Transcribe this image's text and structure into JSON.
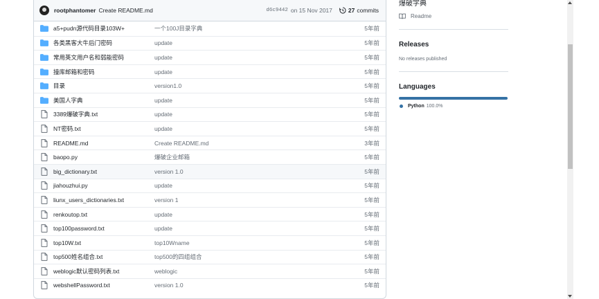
{
  "commit": {
    "author": "rootphantomer",
    "message": "Create README.md",
    "sha": "d6c9442",
    "date": "on 15 Nov 2017",
    "count": "27",
    "count_label": "commits"
  },
  "files": [
    {
      "type": "dir",
      "name": "a5+pudn源代码目录103W+",
      "msg": "一个100J目录字典",
      "date": "5年前"
    },
    {
      "type": "dir",
      "name": "各类黑客大牛后门密码",
      "msg": "update",
      "date": "5年前"
    },
    {
      "type": "dir",
      "name": "常用英文用户名和弱能密码",
      "msg": "update",
      "date": "5年前"
    },
    {
      "type": "dir",
      "name": "撞库邮箱和密码",
      "msg": "update",
      "date": "5年前"
    },
    {
      "type": "dir",
      "name": "目录",
      "msg": "version1.0",
      "date": "5年前"
    },
    {
      "type": "dir",
      "name": "美国人字典",
      "msg": "update",
      "date": "5年前"
    },
    {
      "type": "file",
      "name": "3389爆破字典.txt",
      "msg": "update",
      "date": "5年前"
    },
    {
      "type": "file",
      "name": "NT密码.txt",
      "msg": "update",
      "date": "5年前"
    },
    {
      "type": "file",
      "name": "README.md",
      "msg": "Create README.md",
      "date": "3年前"
    },
    {
      "type": "file",
      "name": "baopo.py",
      "msg": "爆破企业邮箱",
      "date": "5年前"
    },
    {
      "type": "file",
      "name": "big_dictionary.txt",
      "msg": "version 1.0",
      "date": "5年前"
    },
    {
      "type": "file",
      "name": "jiahouzhui.py",
      "msg": "update",
      "date": "5年前"
    },
    {
      "type": "file",
      "name": "liunx_users_dictionaries.txt",
      "msg": "version 1",
      "date": "5年前"
    },
    {
      "type": "file",
      "name": "renkoutop.txt",
      "msg": "update",
      "date": "5年前"
    },
    {
      "type": "file",
      "name": "top100password.txt",
      "msg": "update",
      "date": "5年前"
    },
    {
      "type": "file",
      "name": "top10W.txt",
      "msg": "top10Wname",
      "date": "5年前"
    },
    {
      "type": "file",
      "name": "top500姓名组合.txt",
      "msg": "top500的四组组合",
      "date": "5年前"
    },
    {
      "type": "file",
      "name": "weblogic默认密码列表.txt",
      "msg": "weblogic",
      "date": "5年前"
    },
    {
      "type": "file",
      "name": "webshellPassword.txt",
      "msg": "version 1.0",
      "date": "5年前"
    }
  ],
  "sidebar": {
    "about_topic": "爆破字典",
    "readme": "Readme",
    "releases_title": "Releases",
    "releases_text": "No releases published",
    "languages_title": "Languages",
    "language": {
      "name": "Python",
      "percent": "100.0%",
      "color": "#3572A5"
    }
  }
}
